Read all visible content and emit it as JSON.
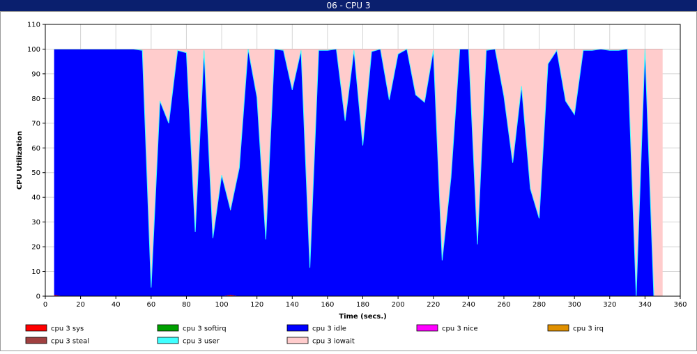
{
  "window": {
    "title": "06 - CPU 3"
  },
  "colors": {
    "sys": "#ff0000",
    "softirq": "#00a000",
    "idle": "#0000ff",
    "nice": "#ff00ff",
    "irq": "#e09000",
    "steal": "#a04040",
    "user": "#40ffff",
    "iowait": "#ffcccc"
  },
  "chart_data": {
    "type": "area",
    "stacked": true,
    "xlabel": "Time (secs.)",
    "ylabel": "CPU Utilization",
    "xlim": [
      0,
      360
    ],
    "ylim": [
      0,
      110
    ],
    "xticks": [
      0,
      20,
      40,
      60,
      80,
      100,
      120,
      140,
      160,
      180,
      200,
      220,
      240,
      260,
      280,
      300,
      320,
      340,
      360
    ],
    "yticks": [
      0,
      10,
      20,
      30,
      40,
      50,
      60,
      70,
      80,
      90,
      100,
      110
    ],
    "grid": true,
    "legend_position": "bottom",
    "x": [
      5,
      10,
      15,
      20,
      25,
      30,
      35,
      40,
      45,
      50,
      55,
      60,
      65,
      70,
      75,
      80,
      85,
      90,
      95,
      100,
      105,
      110,
      115,
      120,
      125,
      130,
      135,
      140,
      145,
      150,
      155,
      160,
      165,
      170,
      175,
      180,
      185,
      190,
      195,
      200,
      205,
      210,
      215,
      220,
      225,
      230,
      235,
      240,
      245,
      250,
      255,
      260,
      265,
      270,
      275,
      280,
      285,
      290,
      295,
      300,
      305,
      310,
      315,
      320,
      325,
      330,
      335,
      340,
      345,
      350
    ],
    "series": [
      {
        "name": "cpu 3 sys",
        "values": [
          0.5,
          0,
          0,
          0,
          0,
          0,
          0,
          0,
          0,
          0,
          0,
          0,
          0,
          0,
          0,
          0,
          0,
          0,
          0,
          0,
          0.5,
          0,
          0,
          0,
          0,
          0,
          0,
          0,
          0,
          0,
          0,
          0,
          0,
          0,
          0,
          0,
          0,
          0,
          0,
          0,
          0,
          0,
          0,
          0,
          0,
          0,
          0,
          0,
          0,
          0,
          0,
          0,
          0,
          0,
          0,
          0,
          0,
          0,
          0,
          0,
          0,
          0,
          0,
          0,
          0,
          0,
          0,
          0,
          0,
          0
        ]
      },
      {
        "name": "cpu 3 softirq",
        "values": [
          0,
          0,
          0,
          0,
          0,
          0,
          0,
          0,
          0,
          0,
          0,
          0,
          0,
          0,
          0,
          0,
          0,
          0,
          0,
          0,
          0,
          0,
          0,
          0,
          0,
          0,
          0,
          0,
          0,
          0,
          0,
          0,
          0,
          0,
          0,
          0,
          0,
          0,
          0,
          0,
          0,
          0,
          0,
          0,
          0,
          0,
          0,
          0,
          0,
          0,
          0,
          0,
          0,
          0,
          0,
          0,
          0,
          0,
          0,
          0,
          0,
          0,
          0,
          0,
          0,
          0,
          0,
          0,
          0,
          0
        ]
      },
      {
        "name": "cpu 3 idle",
        "values": [
          99.5,
          100,
          100,
          100,
          100,
          100,
          100,
          100,
          100,
          100,
          99.5,
          3.5,
          79,
          70,
          99.5,
          98.5,
          26,
          99.5,
          23.5,
          49,
          34,
          52,
          100,
          80.5,
          23,
          100,
          99.5,
          83.5,
          99.5,
          11.5,
          99.5,
          99.5,
          100,
          71,
          99.5,
          61,
          99,
          100,
          79.5,
          98,
          100,
          81.5,
          78.5,
          99.5,
          14.5,
          48,
          100,
          100,
          21,
          99.5,
          100,
          81,
          54,
          85,
          43.5,
          31.5,
          94,
          99.5,
          79,
          73.5,
          99.5,
          99.5,
          100,
          99.5,
          99.5,
          100,
          0,
          100,
          0,
          0
        ]
      },
      {
        "name": "cpu 3 nice",
        "values": [
          0,
          0,
          0,
          0,
          0,
          0,
          0,
          0,
          0,
          0,
          0,
          0,
          0,
          0,
          0,
          0,
          0,
          0,
          0,
          0,
          0,
          0,
          0,
          0,
          0,
          0,
          0,
          0,
          0,
          0,
          0,
          0,
          0,
          0,
          0,
          0,
          0,
          0,
          0,
          0,
          0,
          0,
          0,
          0,
          0,
          0,
          0,
          0,
          0,
          0,
          0,
          0,
          0,
          0,
          0,
          0,
          0,
          0,
          0,
          0,
          0,
          0,
          0,
          0,
          0,
          0,
          0,
          0,
          0,
          0
        ]
      },
      {
        "name": "cpu 3 irq",
        "values": [
          0,
          0,
          0,
          0,
          0,
          0,
          0,
          0,
          0,
          0,
          0,
          0,
          0,
          0,
          0,
          0,
          0,
          0,
          0,
          0,
          0.5,
          0,
          0,
          0,
          0,
          0,
          0,
          0,
          0,
          0,
          0,
          0,
          0,
          0,
          0,
          0,
          0,
          0,
          0,
          0,
          0,
          0,
          0,
          0,
          0,
          0,
          0,
          0,
          0,
          0,
          0,
          0,
          0,
          0,
          0,
          0,
          0,
          0,
          0,
          0,
          0,
          0,
          0,
          0,
          0,
          0,
          0,
          0,
          0,
          0
        ]
      },
      {
        "name": "cpu 3 steal",
        "values": [
          0,
          0,
          0,
          0,
          0,
          0,
          0,
          0,
          0,
          0,
          0,
          0,
          0,
          0,
          0,
          0,
          0,
          0,
          0,
          0,
          0,
          0,
          0,
          0,
          0,
          0,
          0,
          0,
          0,
          0,
          0,
          0,
          0,
          0,
          0,
          0,
          0,
          0,
          0,
          0,
          0,
          0,
          0,
          0,
          0,
          0,
          0,
          0,
          0,
          0,
          0,
          0,
          0,
          0,
          0,
          0,
          0,
          0,
          0,
          0,
          0,
          0,
          0,
          0,
          0,
          0,
          0,
          0,
          0,
          0
        ]
      },
      {
        "name": "cpu 3 user",
        "values": [
          0,
          0,
          0,
          0,
          0,
          0,
          0,
          0,
          0,
          0,
          0,
          0,
          0,
          0,
          0,
          0,
          0,
          0,
          0,
          0,
          0,
          0,
          0,
          0,
          0,
          0,
          0,
          0,
          0,
          0,
          0,
          0,
          0,
          0,
          0,
          0,
          0,
          0,
          0,
          0,
          0,
          0,
          0,
          0,
          0,
          0,
          0,
          0,
          0,
          0,
          0,
          0,
          0,
          0,
          0,
          0,
          0,
          0,
          0,
          0,
          0,
          0,
          0,
          0,
          0,
          0,
          0,
          0,
          0,
          0
        ]
      },
      {
        "name": "cpu 3 iowait",
        "values": [
          0,
          0,
          0,
          0,
          0,
          0,
          0,
          0,
          0,
          0,
          0.5,
          96.5,
          21,
          30,
          0.5,
          1.5,
          74,
          0.5,
          76.5,
          51,
          65,
          48,
          0,
          19.5,
          77,
          0,
          0.5,
          16.5,
          0.5,
          88.5,
          0.5,
          0.5,
          0,
          29,
          0.5,
          39,
          1,
          0,
          20.5,
          2,
          0,
          18.5,
          21.5,
          0.5,
          85.5,
          52,
          0,
          0,
          79,
          0.5,
          0,
          19,
          46,
          15,
          56.5,
          68.5,
          6,
          0.5,
          21,
          26.5,
          0.5,
          0.5,
          0,
          0.5,
          0.5,
          0,
          100,
          0,
          100,
          100
        ]
      }
    ]
  }
}
